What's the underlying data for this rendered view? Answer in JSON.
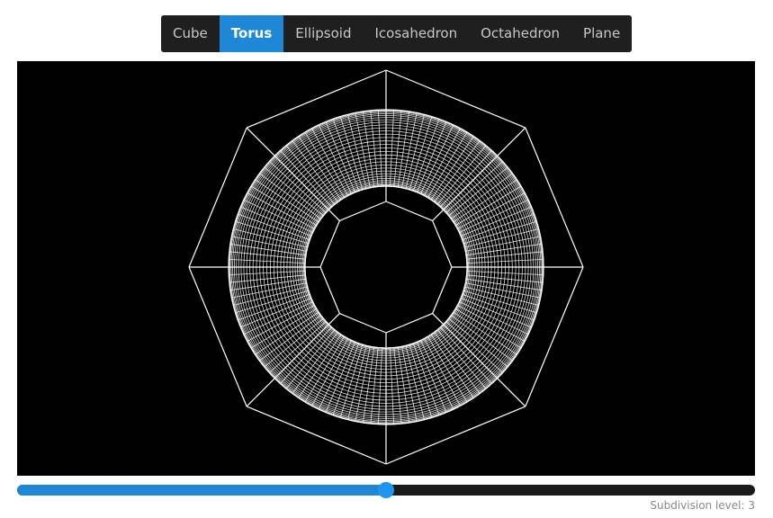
{
  "tabs": [
    {
      "label": "Cube",
      "active": false
    },
    {
      "label": "Torus",
      "active": true
    },
    {
      "label": "Ellipsoid",
      "active": false
    },
    {
      "label": "Icosahedron",
      "active": false
    },
    {
      "label": "Octahedron",
      "active": false
    },
    {
      "label": "Plane",
      "active": false
    }
  ],
  "viewer": {
    "shape": "Torus",
    "background_color": "#000000",
    "wire_color": "#ffffff"
  },
  "slider": {
    "value": 3,
    "min": 0,
    "max": 6,
    "fill_color": "#1e88d6"
  },
  "status": {
    "text": "Subdivision level: 3"
  }
}
